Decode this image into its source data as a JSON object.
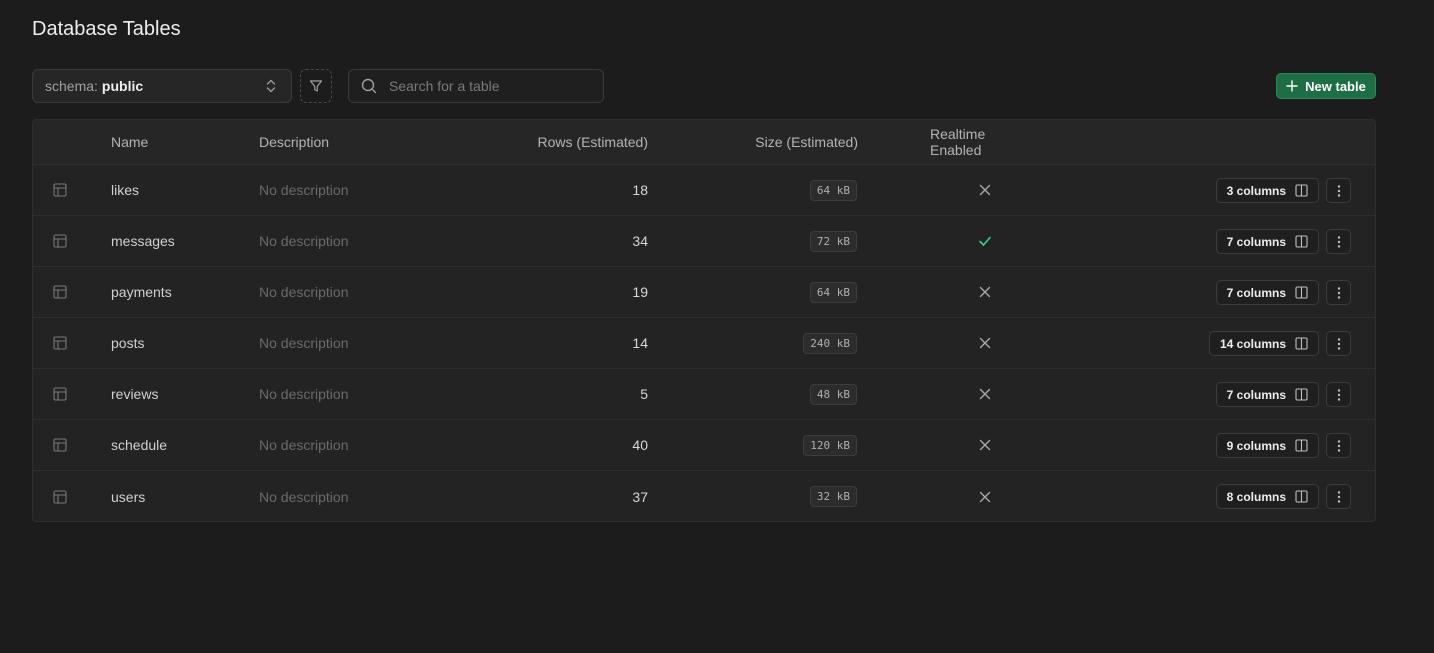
{
  "page": {
    "title": "Database Tables"
  },
  "toolbar": {
    "schema_prefix": "schema:",
    "schema_value": "public",
    "search_placeholder": "Search for a table",
    "new_table_label": "New table"
  },
  "table": {
    "headers": {
      "name": "Name",
      "description": "Description",
      "rows": "Rows (Estimated)",
      "size": "Size (Estimated)",
      "realtime": "Realtime Enabled"
    },
    "rows": [
      {
        "name": "likes",
        "description": "No description",
        "rows": "18",
        "size": "64 kB",
        "realtime": false,
        "columns": "3 columns"
      },
      {
        "name": "messages",
        "description": "No description",
        "rows": "34",
        "size": "72 kB",
        "realtime": true,
        "columns": "7 columns"
      },
      {
        "name": "payments",
        "description": "No description",
        "rows": "19",
        "size": "64 kB",
        "realtime": false,
        "columns": "7 columns"
      },
      {
        "name": "posts",
        "description": "No description",
        "rows": "14",
        "size": "240 kB",
        "realtime": false,
        "columns": "14 columns"
      },
      {
        "name": "reviews",
        "description": "No description",
        "rows": "5",
        "size": "48 kB",
        "realtime": false,
        "columns": "7 columns"
      },
      {
        "name": "schedule",
        "description": "No description",
        "rows": "40",
        "size": "120 kB",
        "realtime": false,
        "columns": "9 columns"
      },
      {
        "name": "users",
        "description": "No description",
        "rows": "37",
        "size": "32 kB",
        "realtime": false,
        "columns": "8 columns"
      }
    ]
  },
  "icons": {
    "table_row": "table-icon",
    "realtime_on": "check-icon",
    "realtime_off": "x-icon",
    "columns": "columns-icon",
    "more": "more-vertical-icon"
  },
  "colors": {
    "background": "#1c1c1c",
    "accent": "#1d6e45",
    "check": "#3ecf8e"
  }
}
